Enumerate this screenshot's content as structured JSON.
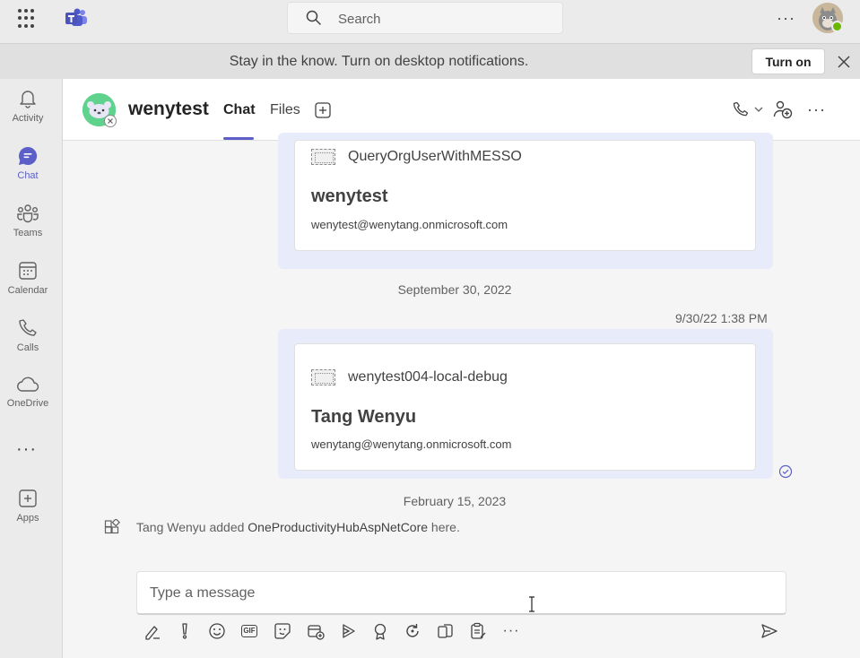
{
  "topbar": {
    "search_placeholder": "Search",
    "more_label": "···"
  },
  "notification": {
    "text": "Stay in the know. Turn on desktop notifications.",
    "button_label": "Turn on"
  },
  "rail": {
    "items": [
      {
        "label": "Activity",
        "icon": "bell-icon"
      },
      {
        "label": "Chat",
        "icon": "chat-icon",
        "active": true
      },
      {
        "label": "Teams",
        "icon": "teams-icon"
      },
      {
        "label": "Calendar",
        "icon": "calendar-icon"
      },
      {
        "label": "Calls",
        "icon": "phone-icon"
      },
      {
        "label": "OneDrive",
        "icon": "cloud-icon"
      },
      {
        "label": "Apps",
        "icon": "plus-box-icon"
      }
    ],
    "more_label": "···"
  },
  "header": {
    "title": "wenytest",
    "tabs": [
      {
        "label": "Chat",
        "active": true
      },
      {
        "label": "Files"
      }
    ],
    "more_label": "···"
  },
  "messages": {
    "card1": {
      "app_name": "QueryOrgUserWithMESSO",
      "title": "wenytest",
      "email": "wenytest@wenytang.onmicrosoft.com"
    },
    "date1": "September 30, 2022",
    "msg2_time": "9/30/22 1:38 PM",
    "card2": {
      "app_name": "wenytest004-local-debug",
      "title": "Tang Wenyu",
      "email": "wenytang@wenytang.onmicrosoft.com"
    },
    "date2": "February 15, 2023",
    "system": {
      "actor_text": "Tang Wenyu added ",
      "app_name": "OneProductivityHubAspNetCore",
      "suffix": " here."
    }
  },
  "compose": {
    "placeholder": "Type a message",
    "gif_label": "GIF",
    "more_label": "···"
  },
  "colors": {
    "accent": "#5b5fc7",
    "bubble": "#e8ebfa",
    "presence_available": "#6bb700",
    "bot_avatar": "#5fd38d"
  }
}
